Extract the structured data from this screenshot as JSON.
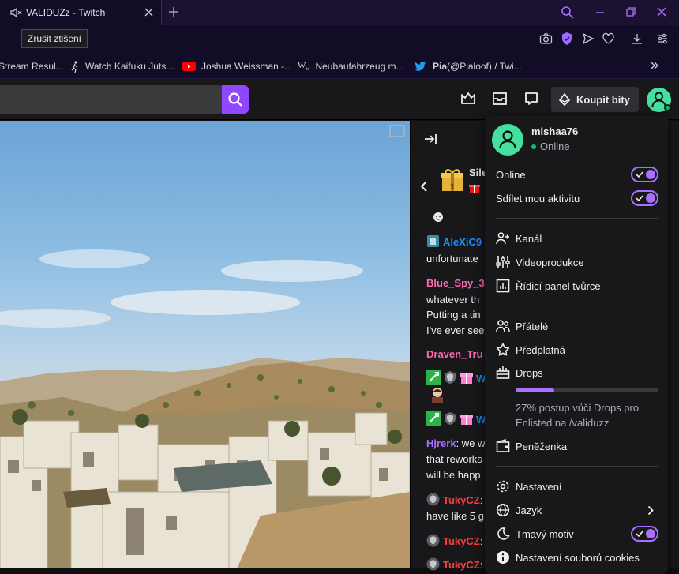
{
  "browser": {
    "tab_title": "VALIDUZz - Twitch",
    "tooltip": "Zrušit ztišení",
    "bookmarks": [
      {
        "text": "Stream Resul..."
      },
      {
        "text": "Watch Kaifuku Juts..."
      },
      {
        "text": "Joshua Weissman -..."
      },
      {
        "text": "Neubaufahrzeug m..."
      },
      {
        "bold": "Pia",
        "text": " (@Pialoof) / Twi..."
      }
    ]
  },
  "topnav": {
    "bits_label": "Koupit bity"
  },
  "chat": {
    "header_name": "Sile",
    "lines": [
      {
        "name": "AleXiC9",
        "color": "#1e90ff",
        "text": ""
      },
      {
        "name": "",
        "color": "#efeff1",
        "text": "unfortunate"
      },
      {
        "name": "Blue_Spy_3",
        "color": "#ff69b4",
        "text": ""
      },
      {
        "name": "",
        "color": "#efeff1",
        "text": "whatever th"
      },
      {
        "name": "",
        "color": "#efeff1",
        "text": "Putting a tin"
      },
      {
        "name": "",
        "color": "#efeff1",
        "text": "I've ever see"
      },
      {
        "name": "Draven_Tru",
        "color": "#ff69b4",
        "text": ""
      },
      {
        "name": "W",
        "color": "#1e90ff",
        "text": ""
      },
      {
        "name": "W",
        "color": "#1e90ff",
        "text": ""
      },
      {
        "name": "Hjrerk",
        "color": "#a970ff",
        "text": ": we w"
      },
      {
        "name": "",
        "color": "#efeff1",
        "text": "that reworks"
      },
      {
        "name": "",
        "color": "#efeff1",
        "text": "will be happ"
      },
      {
        "name": "TukyCZ",
        "color": "#ff3b3b",
        "text": ":"
      },
      {
        "name": "",
        "color": "#efeff1",
        "text": "have like 5 g"
      },
      {
        "name": "TukyCZ",
        "color": "#ff3b3b",
        "text": ":"
      },
      {
        "name": "TukyCZ",
        "color": "#ff3b3b",
        "text": ":"
      }
    ]
  },
  "menu": {
    "username": "mishaa76",
    "status": "Online",
    "toggles": {
      "online": "Online",
      "share_activity": "Sdílet mou aktivitu",
      "dark_mode": "Tmavý motiv"
    },
    "items": {
      "channel": "Kanál",
      "video_production": "Videoprodukce",
      "creator_dashboard": "Řídicí panel tvůrce",
      "friends": "Přátelé",
      "subscriptions": "Předplatná",
      "drops": "Drops",
      "drops_progress_text_1": "27% postup vůči Drops pro",
      "drops_progress_text_2": "Enlisted na /validuzz",
      "wallet": "Peněženka",
      "settings": "Nastavení",
      "language": "Jazyk",
      "cookie_settings": "Nastavení souborů cookies"
    },
    "drops_progress": 0.27
  },
  "colors": {
    "accent": "#9147ff",
    "toggle": "#a970ff",
    "online": "#00c56a",
    "avatar": "#45e0a0"
  }
}
